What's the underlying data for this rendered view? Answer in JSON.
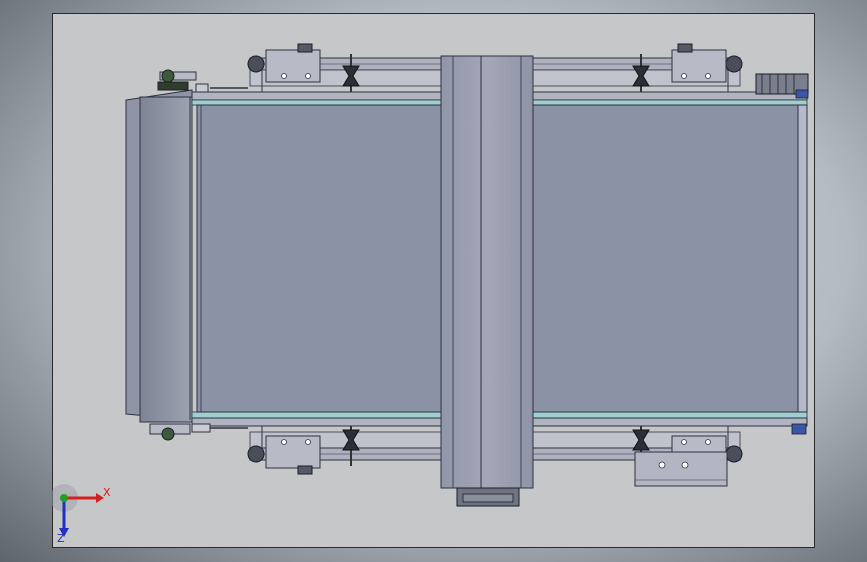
{
  "viewport": {
    "background_center": "#dfe3e8",
    "background_edge": "#5f656d",
    "sheet_color": "#c6c7c9"
  },
  "colors": {
    "belt": "#8b92a6",
    "frame": "#a8acbb",
    "rail_teal": "#9fd0cf",
    "line": "#2e3140",
    "axis_x": "#d02020",
    "axis_y": "#20a020",
    "axis_z": "#2030c0"
  },
  "triad": {
    "x_label": "X",
    "z_label": "Z"
  }
}
